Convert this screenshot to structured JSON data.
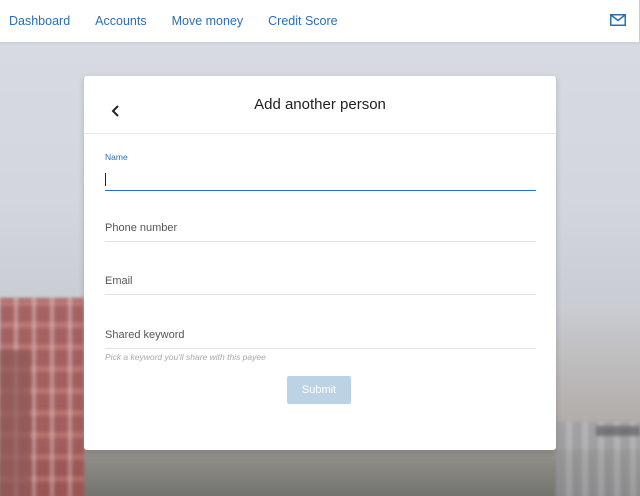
{
  "nav": {
    "items": [
      {
        "label": "Dashboard"
      },
      {
        "label": "Accounts"
      },
      {
        "label": "Move money"
      },
      {
        "label": "Credit Score"
      }
    ],
    "messages_icon": "mail-icon"
  },
  "card": {
    "title": "Add another person",
    "back_icon": "chevron-left-icon",
    "fields": {
      "name": {
        "label": "Name",
        "value": ""
      },
      "phone": {
        "label": "Phone number",
        "value": ""
      },
      "email": {
        "label": "Email",
        "value": ""
      },
      "keyword": {
        "label": "Shared keyword",
        "value": "",
        "hint": "Pick a keyword you'll share with this payee"
      }
    },
    "submit_label": "Submit"
  },
  "colors": {
    "accent": "#2a6fb1",
    "submit_disabled": "#bcd3e6"
  }
}
